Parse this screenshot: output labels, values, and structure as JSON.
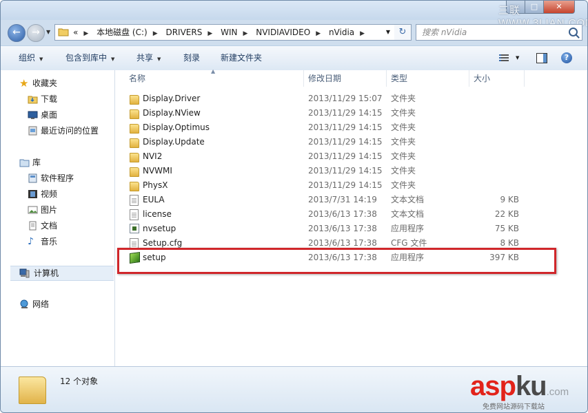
{
  "window": {
    "controls": {
      "minimize": "–",
      "maximize": "□",
      "close": "✕"
    },
    "watermark": "三联 WWW.3LIAN.COM"
  },
  "address": {
    "nav_back": "←",
    "nav_forward": "→",
    "prefix": "«",
    "crumbs": [
      "本地磁盘 (C:)",
      "DRIVERS",
      "WIN",
      "NVIDIAVIDEO",
      "nVidia"
    ],
    "refresh_glyph": "↻"
  },
  "search": {
    "placeholder": "搜索 nVidia"
  },
  "toolbar": {
    "organize": "组织",
    "include_in_library": "包含到库中",
    "share": "共享",
    "burn": "刻录",
    "new_folder": "新建文件夹"
  },
  "sidebar": {
    "favorites": {
      "label": "收藏夹",
      "items": [
        "下载",
        "桌面",
        "最近访问的位置"
      ]
    },
    "libraries": {
      "label": "库",
      "items": [
        "软件程序",
        "视频",
        "图片",
        "文档",
        "音乐"
      ]
    },
    "computer": "计算机",
    "network": "网络"
  },
  "columns": {
    "name": "名称",
    "date": "修改日期",
    "type": "类型",
    "size": "大小"
  },
  "files": [
    {
      "name": "Display.Driver",
      "date": "2013/11/29 15:07",
      "type": "文件夹",
      "size": "",
      "icon": "folder-icon"
    },
    {
      "name": "Display.NView",
      "date": "2013/11/29 14:15",
      "type": "文件夹",
      "size": "",
      "icon": "folder-icon"
    },
    {
      "name": "Display.Optimus",
      "date": "2013/11/29 14:15",
      "type": "文件夹",
      "size": "",
      "icon": "folder-icon"
    },
    {
      "name": "Display.Update",
      "date": "2013/11/29 14:15",
      "type": "文件夹",
      "size": "",
      "icon": "folder-icon"
    },
    {
      "name": "NVI2",
      "date": "2013/11/29 14:15",
      "type": "文件夹",
      "size": "",
      "icon": "folder-icon"
    },
    {
      "name": "NVWMI",
      "date": "2013/11/29 14:15",
      "type": "文件夹",
      "size": "",
      "icon": "folder-icon"
    },
    {
      "name": "PhysX",
      "date": "2013/11/29 14:15",
      "type": "文件夹",
      "size": "",
      "icon": "folder-icon"
    },
    {
      "name": "EULA",
      "date": "2013/7/31 14:19",
      "type": "文本文档",
      "size": "9 KB",
      "icon": "text-document-icon"
    },
    {
      "name": "license",
      "date": "2013/6/13 17:38",
      "type": "文本文档",
      "size": "22 KB",
      "icon": "text-document-icon"
    },
    {
      "name": "nvsetup",
      "date": "2013/6/13 17:38",
      "type": "应用程序",
      "size": "75 KB",
      "icon": "application-icon"
    },
    {
      "name": "Setup.cfg",
      "date": "2013/6/13 17:38",
      "type": "CFG 文件",
      "size": "8 KB",
      "icon": "cfg-file-icon"
    },
    {
      "name": "setup",
      "date": "2013/6/13 17:38",
      "type": "应用程序",
      "size": "397 KB",
      "icon": "nvidia-setup-icon"
    }
  ],
  "status": {
    "item_count": "12 个对象"
  },
  "brand": {
    "part1": "asp",
    "part2": "ku",
    "suffix": ".com",
    "sub": "免费网站源码下载站"
  },
  "colors": {
    "highlight": "#d0262a",
    "selection": "#e5eef8"
  }
}
